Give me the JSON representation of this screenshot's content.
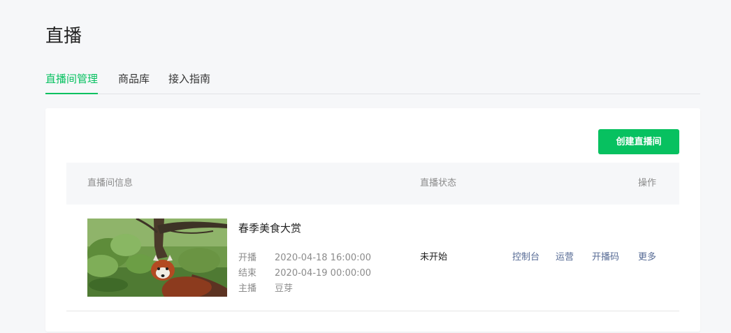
{
  "page": {
    "title": "直播"
  },
  "tabs": [
    {
      "label": "直播间管理",
      "active": true
    },
    {
      "label": "商品库",
      "active": false
    },
    {
      "label": "接入指南",
      "active": false
    }
  ],
  "toolbar": {
    "create_label": "创建直播间"
  },
  "table": {
    "columns": [
      "直播间信息",
      "直播状态",
      "操作"
    ],
    "rows": [
      {
        "name": "春季美食大赏",
        "thumbnail": "red-panda-photo",
        "start_label": "开播",
        "start_value": "2020-04-18 16:00:00",
        "end_label": "结束",
        "end_value": "2020-04-19 00:00:00",
        "host_label": "主播",
        "host_value": "豆芽",
        "status": "未开始",
        "actions": [
          "控制台",
          "运营",
          "开播码",
          "更多"
        ]
      }
    ]
  },
  "colors": {
    "accent": "#07c160",
    "link": "#576b95",
    "background": "#f6f7f9"
  }
}
